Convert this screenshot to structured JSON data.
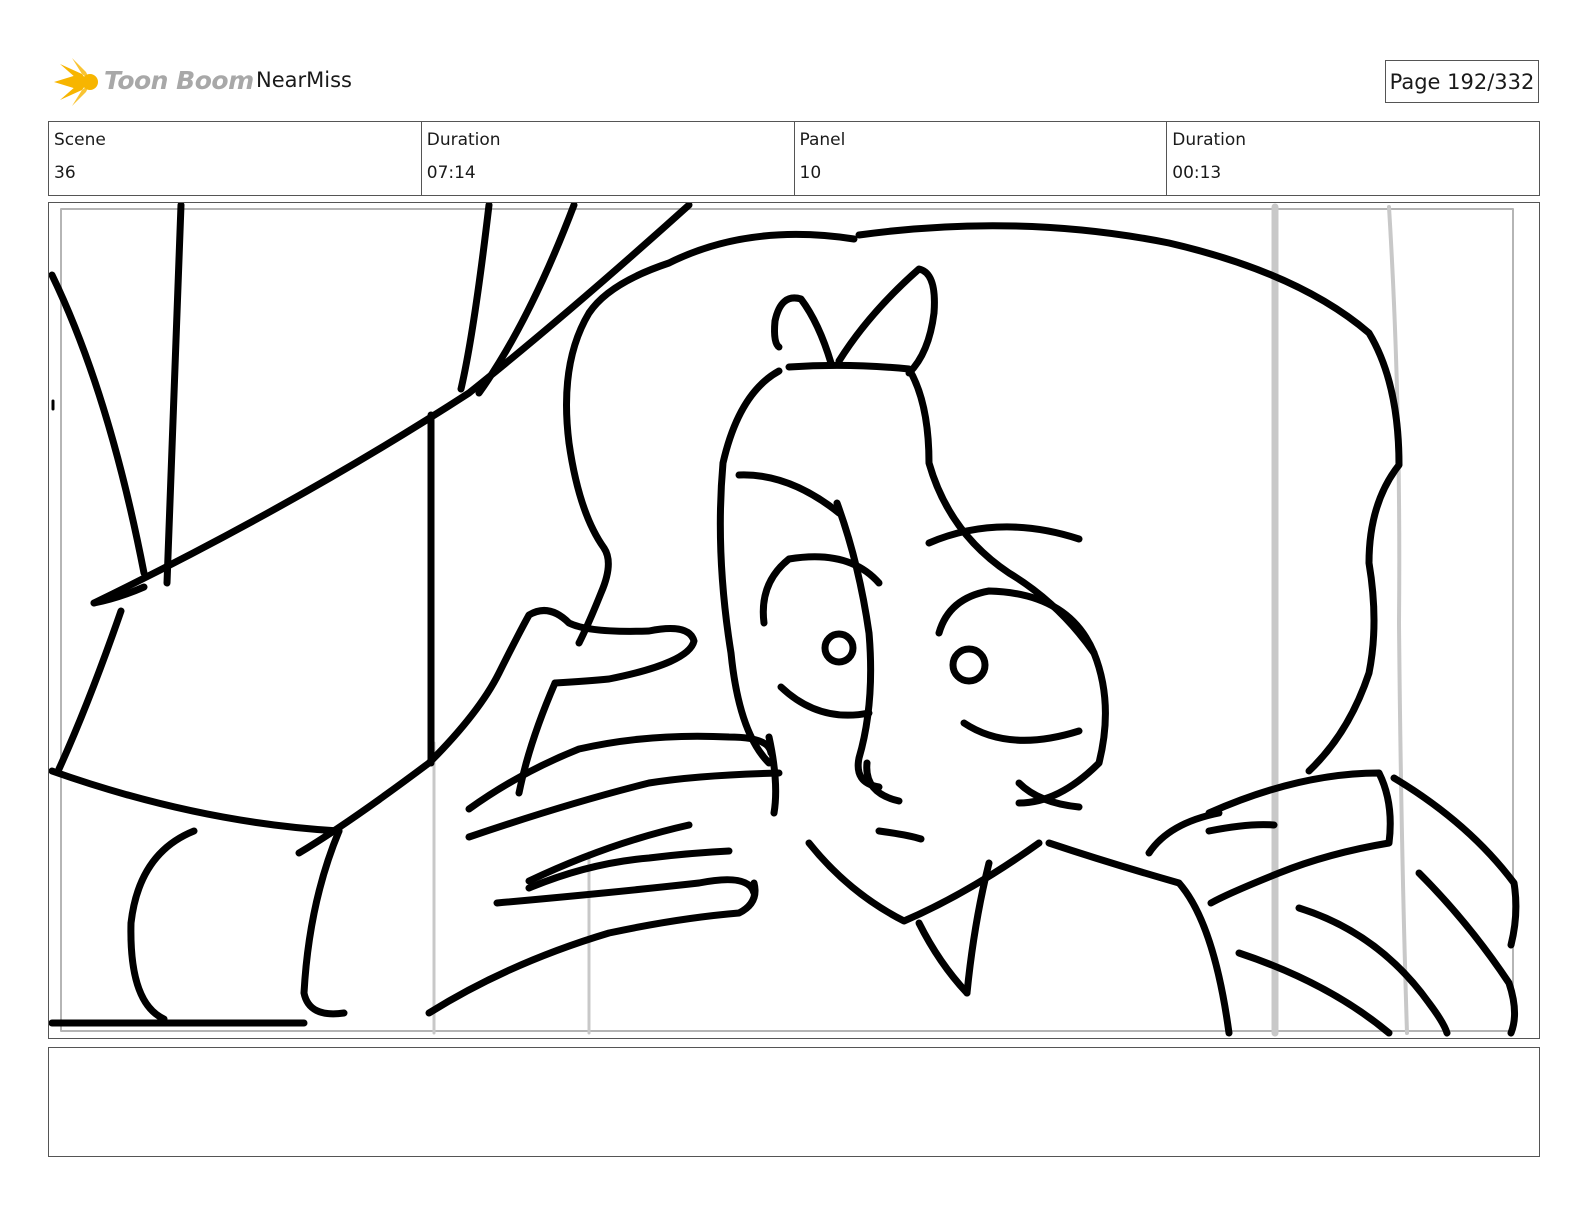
{
  "header": {
    "logo_text": "Toon Boom",
    "project_name": "NearMiss",
    "page_label": "Page 192/332"
  },
  "info": [
    {
      "label": "Scene",
      "value": "36"
    },
    {
      "label": "Duration",
      "value": "07:14"
    },
    {
      "label": "Panel",
      "value": "10"
    },
    {
      "label": "Duration",
      "value": "00:13"
    }
  ],
  "colors": {
    "logo_flare": "#f7b500",
    "logo_text": "#a8a8a8",
    "border": "#555555",
    "ink": "#000000",
    "construction_lines": "#c8c8c8"
  },
  "notes": {
    "text": ""
  }
}
